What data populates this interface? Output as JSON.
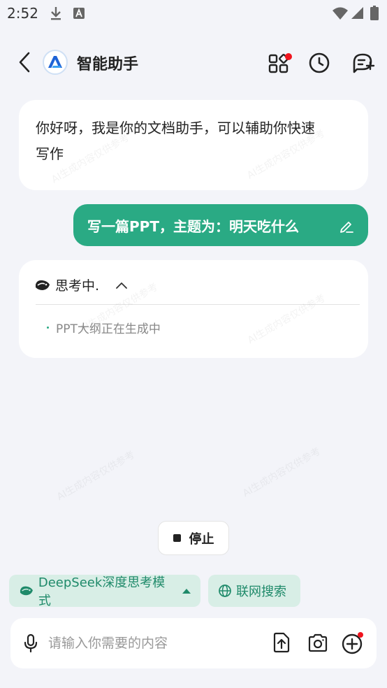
{
  "status": {
    "time": "2:52"
  },
  "header": {
    "title": "智能助手"
  },
  "messages": {
    "ai_greeting_line1": "你好呀，我是你的文档助手，可以辅助你快速",
    "ai_greeting_line2": "写作",
    "user_prompt": "写一篇PPT，主题为：明天吃什么",
    "thinking_label": "思考中.",
    "thinking_step": "PPT大纲正在生成中"
  },
  "watermark": "AI生成内容仅供参考",
  "controls": {
    "stop_label": "停止",
    "deepseek_mode_label": "DeepSeek深度思考模式",
    "web_search_label": "联网搜索"
  },
  "input": {
    "placeholder": "请输入你需要的内容",
    "value": ""
  },
  "colors": {
    "accent": "#2aaa84",
    "chip_bg": "#d8eee6",
    "badge": "#f0141e",
    "background": "#f3f4f9"
  },
  "icons": {
    "status": [
      "download-icon",
      "text-app-icon",
      "wifi-icon",
      "signal-icon",
      "battery-icon"
    ],
    "header": [
      "back-arrow-icon",
      "assistant-logo-icon",
      "apps-grid-icon",
      "history-clock-icon",
      "new-chat-icon"
    ],
    "input": [
      "microphone-icon",
      "upload-file-icon",
      "camera-icon",
      "add-circle-icon"
    ]
  }
}
